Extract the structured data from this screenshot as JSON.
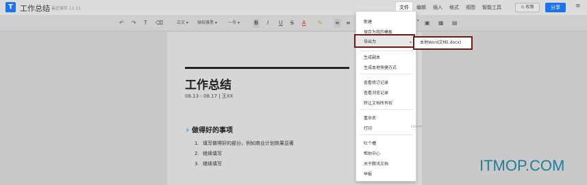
{
  "header": {
    "logo": "T",
    "doc_title": "工作总结",
    "save_status": "最近保存 11:11",
    "tabs": [
      "文件",
      "编辑",
      "插入",
      "格式",
      "视图",
      "智能工具"
    ],
    "permission_label": "权限",
    "share_label": "分享",
    "more_icon": "more-icon"
  },
  "toolbar": {
    "undo": "↶",
    "redo": "↷",
    "format_painter": "T",
    "clear": "⌫",
    "style_select": "正文",
    "font_select": "微软雅黑",
    "size_select": "一号",
    "bold": "B",
    "italic": "I",
    "underline": "U",
    "strike": "S",
    "font_color": "A",
    "highlight": "✎",
    "align": "≡",
    "align2": "≡"
  },
  "document": {
    "title": "工作总结",
    "meta": "08.13 - 08.17 | 王XX",
    "section_heading": "做得好的事项",
    "list": [
      {
        "num": "1.",
        "text": "填写做得好的部分，例如商业计划效果显著"
      },
      {
        "num": "2.",
        "text": "继续填写"
      },
      {
        "num": "3.",
        "text": "继续填写"
      }
    ]
  },
  "file_menu": {
    "items": [
      {
        "label": "新建",
        "arrow": "▸"
      },
      {
        "label": "保存为我的模板"
      },
      {
        "label": "导出为",
        "arrow": "▸"
      },
      {
        "label": "生成副本"
      },
      {
        "label": "生成本地快捷方式"
      },
      {
        "label": "查看修订记录"
      },
      {
        "label": "查看浏览记录"
      },
      {
        "label": "转让文档所有权"
      },
      {
        "label": "重命名"
      },
      {
        "label": "打印",
        "shortcut": "Ctrl+P"
      },
      {
        "label": "吐个槽"
      },
      {
        "label": "帮助中心"
      },
      {
        "label": "关于腾讯文档"
      },
      {
        "label": "举报"
      }
    ]
  },
  "export_submenu": {
    "items": [
      {
        "label": "本地Word文档(.docx)"
      }
    ]
  },
  "watermark": "ITMOP.COM",
  "colors": {
    "accent": "#1e73e8",
    "highlight_border": "#6b1a1a"
  }
}
